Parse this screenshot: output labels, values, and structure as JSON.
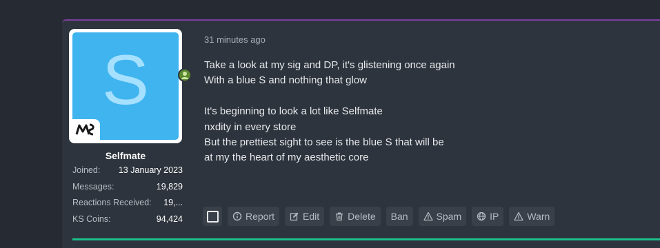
{
  "post": {
    "timestamp": "31 minutes ago",
    "author": {
      "avatar_letter": "S",
      "avatar_color": "#3fb4ef",
      "username": "Selfmate",
      "online": true,
      "stats": [
        {
          "label": "Joined:",
          "value": "13 January 2023"
        },
        {
          "label": "Messages:",
          "value": "19,829"
        },
        {
          "label": "Reactions Received:",
          "value": "19,..."
        },
        {
          "label": "KS Coins:",
          "value": "94,424"
        }
      ]
    },
    "message_lines": [
      "Take a look at my sig and DP, it's glistening once again",
      "With a blue S and nothing that glow",
      "",
      "It's beginning to look a lot like Selfmate",
      "nxdity in every store",
      "But the prettiest sight to see is the blue S that will be",
      "at my the heart of my aesthetic core"
    ],
    "actions": {
      "report": "Report",
      "edit": "Edit",
      "delete": "Delete",
      "ban": "Ban",
      "spam": "Spam",
      "ip": "IP",
      "warn": "Warn"
    }
  },
  "colors": {
    "accent_top": "#7b3fa0",
    "online": "#5c8a2e",
    "bottom_bar": "#1bbf8a"
  }
}
